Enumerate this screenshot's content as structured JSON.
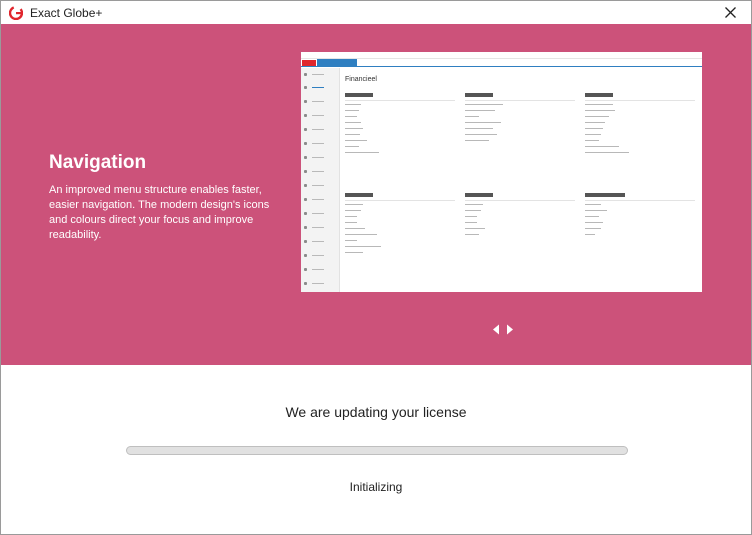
{
  "window": {
    "title": "Exact Globe+"
  },
  "icons": {
    "app": "exact-logo-icon",
    "close": "close-icon",
    "prev": "chevron-left-icon",
    "next": "chevron-right-icon"
  },
  "hero": {
    "title": "Navigation",
    "description": "An improved menu structure enables faster, easier navigation. The modern design's icons and colours direct your focus and improve readability.",
    "background": "#cc527a",
    "preview": {
      "heading": "Financieel"
    }
  },
  "status": {
    "title": "We are updating your license",
    "message": "Initializing",
    "progress": 0
  },
  "colors": {
    "accent": "#cc527a",
    "brand": "#e0262d",
    "progress_track": "#e1e1e1"
  }
}
